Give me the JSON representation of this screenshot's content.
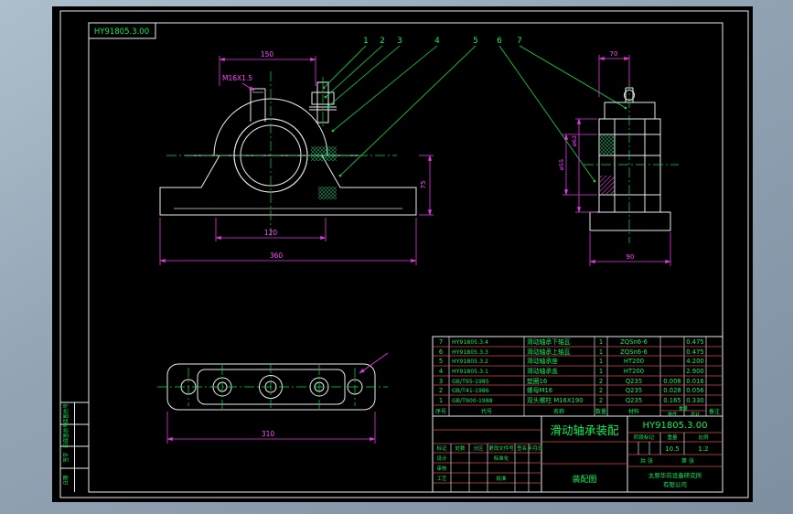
{
  "sheet": {
    "corner_label": "HY91805.3.00",
    "drawing_no": "HY91805.3.00",
    "title": "滑动轴承装配",
    "doc_type": "装配图",
    "company_line1": "太原华向设备研究所",
    "company_line2": "有限公司"
  },
  "balloons": {
    "b1": "1",
    "b2": "2",
    "b3": "3",
    "b4": "4",
    "b5": "5",
    "b6": "6",
    "b7": "7"
  },
  "dims": {
    "thread": "M16X1.5",
    "cap_width": "150",
    "bore_span": "120",
    "base_width": "360",
    "height": "75",
    "side_top": "70",
    "side_bore1": "ø55",
    "side_bore2": "ø62",
    "side_base": "90",
    "plate_length": "310"
  },
  "bom": {
    "header": {
      "no": "序号",
      "code": "代号",
      "name": "名称",
      "qty": "数量",
      "material": "材料",
      "weight": "重量",
      "unit": "单件",
      "total": "总计",
      "remark": "备注"
    },
    "rows": [
      {
        "no": "7",
        "code": "HY91805.3.4",
        "name": "滑动轴承下轴瓦",
        "qty": "1",
        "material": "ZQSn6-6",
        "unit": "",
        "total": "0.475"
      },
      {
        "no": "6",
        "code": "HY91805.3.3",
        "name": "滑动轴承上轴瓦",
        "qty": "1",
        "material": "ZQSn6-6",
        "unit": "",
        "total": "0.475"
      },
      {
        "no": "5",
        "code": "HY91805.3.2",
        "name": "滑动轴承座",
        "qty": "1",
        "material": "HT200",
        "unit": "",
        "total": "4.200"
      },
      {
        "no": "4",
        "code": "HY91805.3.1",
        "name": "滑动轴承盖",
        "qty": "1",
        "material": "HT200",
        "unit": "",
        "total": "2.900"
      },
      {
        "no": "3",
        "code": "GB/T95-1985",
        "name": "垫圈16",
        "qty": "2",
        "material": "Q235",
        "unit": "0.008",
        "total": "0.016"
      },
      {
        "no": "2",
        "code": "GB/T41-1986",
        "name": "螺母M16",
        "qty": "2",
        "material": "Q235",
        "unit": "0.028",
        "total": "0.056"
      },
      {
        "no": "1",
        "code": "GB/T900-1988",
        "name": "双头螺柱 M16X190",
        "qty": "2",
        "material": "Q235",
        "unit": "0.165",
        "total": "0.330"
      }
    ]
  },
  "titleblock": {
    "mark": "标记",
    "count": "处数",
    "zone": "分区",
    "change_doc": "更改文件号",
    "sign": "签名",
    "date": "年月日",
    "design": "设计",
    "standardize": "标准化",
    "review": "审核",
    "process": "工艺",
    "approve": "批准",
    "stage_label": "阶段标记",
    "weight_label": "重量",
    "scale_label": "比例",
    "weight_value": "10.5",
    "scale_value": "1:2",
    "sheets": "共 张",
    "page": "第 张"
  },
  "margin_strip": {
    "c1": "底图总号",
    "c2": "旧底图总号",
    "c3": "签字",
    "c4": "日期"
  }
}
